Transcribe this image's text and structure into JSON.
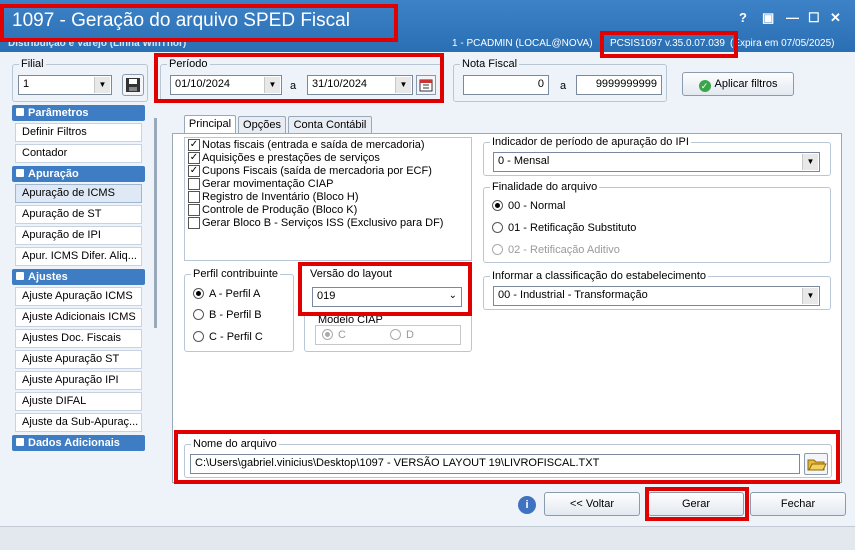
{
  "window": {
    "title": "1097 - Geração do arquivo SPED Fiscal",
    "subtitle": "Distribuição e Varejo (Linha WinThor)",
    "session": "1 - PCADMIN (LOCAL@NOVA)",
    "version": "PCSIS1097  v.35.0.07.039",
    "expires": "(Expira em 07/05/2025)",
    "controls": [
      "?",
      "▣",
      "—",
      "☐",
      "✕"
    ]
  },
  "filial": {
    "legend": "Filial",
    "value": "1"
  },
  "periodo": {
    "legend": "Período",
    "start": "01/10/2024",
    "separator": "a",
    "end": "31/10/2024"
  },
  "nota_fiscal": {
    "legend": "Nota Fiscal",
    "start": "0",
    "separator": "a",
    "end": "9999999999"
  },
  "apply_filters_label": "Aplicar filtros",
  "sidebar": {
    "groups": [
      {
        "label": "Parâmetros",
        "items": [
          "Definir Filtros",
          "Contador"
        ]
      },
      {
        "label": "Apuração",
        "items": [
          "Apuração de ICMS",
          "Apuração de ST",
          "Apuração de IPI",
          "Apur. ICMS Difer. Aliq..."
        ]
      },
      {
        "label": "Ajustes",
        "items": [
          "Ajuste Apuração ICMS",
          "Ajuste Adicionais ICMS",
          "Ajustes Doc. Fiscais",
          "Ajuste Apuração ST",
          "Ajuste Apuração IPI",
          "Ajuste DIFAL",
          "Ajuste da Sub-Apuraç..."
        ]
      },
      {
        "label": "Dados Adicionais",
        "items": []
      }
    ]
  },
  "tabs": [
    "Principal",
    "Opções",
    "Conta Contábil"
  ],
  "checklist": [
    {
      "label": "Notas fiscais (entrada e saída de mercadoria)",
      "checked": true
    },
    {
      "label": "Aquisições e prestações de serviços",
      "checked": true
    },
    {
      "label": "Cupons Fiscais (saída de mercadoria por ECF)",
      "checked": true
    },
    {
      "label": "Gerar movimentação CIAP",
      "checked": false
    },
    {
      "label": "Registro de Inventário (Bloco H)",
      "checked": false
    },
    {
      "label": "Controle de Produção (Bloco K)",
      "checked": false
    },
    {
      "label": "Gerar Bloco B - Serviços ISS (Exclusivo para DF)",
      "checked": false
    }
  ],
  "perfil": {
    "legend": "Perfil contribuinte",
    "options": [
      "A - Perfil A",
      "B - Perfil B",
      "C - Perfil C"
    ],
    "selected": 0
  },
  "layout": {
    "legend": "Versão do layout",
    "value": "019"
  },
  "ciap": {
    "legend": "Modelo CIAP",
    "options": [
      "C",
      "D"
    ],
    "selected": 0
  },
  "ipi": {
    "legend": "Indicador de período de apuração do IPI",
    "value": "0 - Mensal"
  },
  "finalidade": {
    "legend": "Finalidade do arquivo",
    "options": [
      "00 - Normal",
      "01 - Retificação Substituto",
      "02 - Retificação Aditivo"
    ],
    "selected": 0
  },
  "classificacao": {
    "legend": "Informar a classificação do estabelecimento",
    "value": "00 - Industrial - Transformação"
  },
  "arquivo": {
    "legend": "Nome do arquivo",
    "path": "C:\\Users\\gabriel.vinicius\\Desktop\\1097 - VERSÃO LAYOUT 19\\LIVROFISCAL.TXT"
  },
  "buttons": {
    "back": "<< Voltar",
    "generate": "Gerar",
    "close": "Fechar"
  },
  "colors": {
    "highlight": "#e00000",
    "titlebar": "#2a6fb4",
    "sidebar_group": "#3e7cc4"
  }
}
